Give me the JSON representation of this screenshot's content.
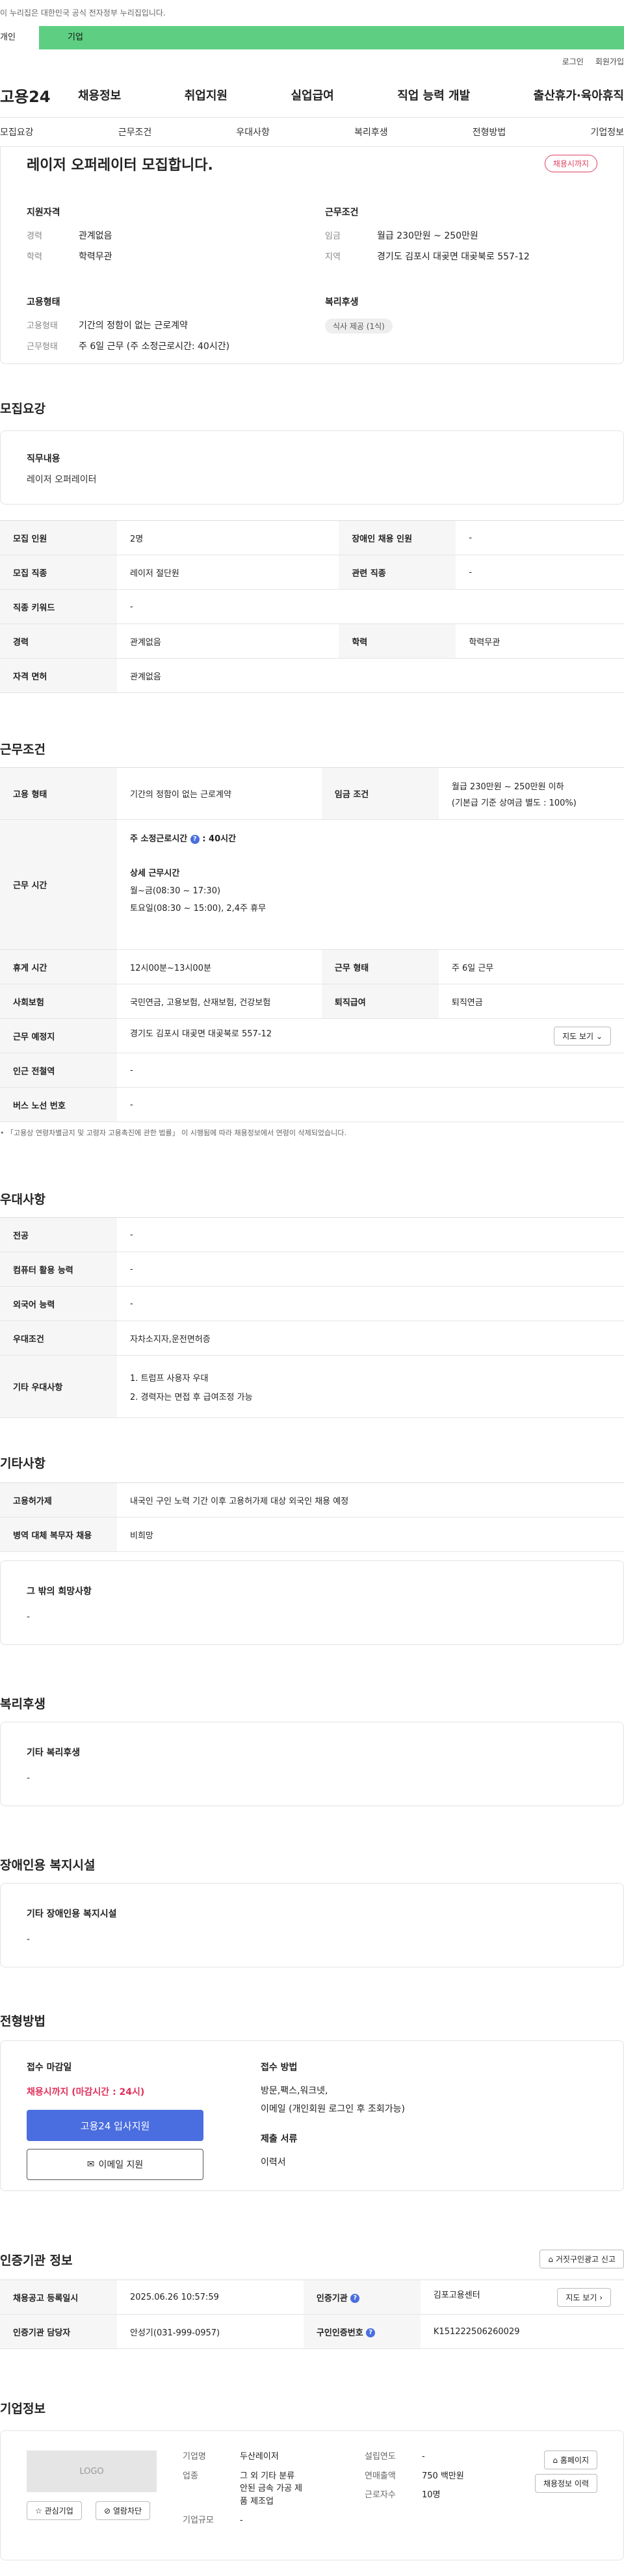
{
  "gov_notice": "이 누리집은 대한민국 공식 전자정부 누리집입니다.",
  "top_tabs": {
    "individual": "개인",
    "company": "기업"
  },
  "util": {
    "login": "로그인",
    "join": "회원가입"
  },
  "logo": "고용24",
  "gnb": [
    "채용정보",
    "취업지원",
    "실업급여",
    "직업 능력 개발",
    "출산휴가·육아휴직"
  ],
  "subnav": [
    "모집요강",
    "근무조건",
    "우대사항",
    "복리후생",
    "전형방법",
    "기업정보"
  ],
  "summary": {
    "title": "레이저 오퍼레이터 모집합니다.",
    "badge": "채용시까지",
    "qual_h": "지원자격",
    "qual": [
      {
        "k": "경력",
        "v": "관계없음"
      },
      {
        "k": "학력",
        "v": "학력무관"
      }
    ],
    "cond_h": "근무조건",
    "cond": [
      {
        "k": "임금",
        "v": "월급 230만원 ~ 250만원"
      },
      {
        "k": "지역",
        "v": "경기도 김포시 대곶면 대곶북로 557-12"
      }
    ],
    "emp_h": "고용형태",
    "emp": [
      {
        "k": "고용형태",
        "v": "기간의 정함이 없는 근로계약"
      },
      {
        "k": "근무형태",
        "v": "주 6일 근무 (주 소정근로시간: 40시간)"
      }
    ],
    "welfare_h": "복리후생",
    "welfare_chip": "식사 제공 (1식)"
  },
  "recruit": {
    "title": "모집요강",
    "job_lbl": "직무내용",
    "job_val": "레이저 오퍼레이터",
    "rows": [
      [
        "모집 인원",
        "2명",
        "장애인 채용 인원",
        "-"
      ],
      [
        "모집 직종",
        "레이저 절단원",
        "관련 직종",
        "-"
      ],
      [
        "직종 키워드",
        "-",
        "",
        ""
      ],
      [
        "경력",
        "관계없음",
        "학력",
        "학력무관"
      ],
      [
        "자격 면허",
        "관계없음",
        "",
        ""
      ]
    ]
  },
  "work": {
    "title": "근무조건",
    "type_k": "고용 형태",
    "type_v": "기간의 정함이 없는 근로계약",
    "wage_k": "임금 조건",
    "wage_v1": "월급 230만원 ~ 250만원 이하",
    "wage_v2": "(기본급 기준 상여금 별도 : 100%)",
    "hours_k": "근무 시간",
    "hours_main": "주 소정근로시간",
    "hours_num": ": 40시간",
    "hours_detail_h": "상세 근무시간",
    "hours_d1": "월~금(08:30 ~ 17:30)",
    "hours_d2": "토요일(08:30 ~ 15:00), 2,4주 휴무",
    "rest_k": "휴게 시간",
    "rest_v": "12시00분~13시00분",
    "form_k": "근무 형태",
    "form_v": "주 6일 근무",
    "ins_k": "사회보험",
    "ins_v": "국민연금, 고용보험, 산재보험, 건강보험",
    "sev_k": "퇴직급여",
    "sev_v": "퇴직연금",
    "place_k": "근무 예정지",
    "place_v": "경기도 김포시 대곶면 대곶북로 557-12",
    "map_btn": "지도 보기",
    "sub_k": "인근 전철역",
    "sub_v": "-",
    "bus_k": "버스 노선 번호",
    "bus_v": "-",
    "note": "「고용상 연령차별금지 및 고령자 고용촉진에 관한 법률」 이 시행됨에 따라 채용정보에서 연령이 삭제되었습니다."
  },
  "pref": {
    "title": "우대사항",
    "rows": [
      [
        "전공",
        "-"
      ],
      [
        "컴퓨터 활용 능력",
        "-"
      ],
      [
        "외국어 능력",
        "-"
      ],
      [
        "우대조건",
        "자차소지자,운전면허증"
      ]
    ],
    "etc_k": "기타 우대사항",
    "etc_1": "1. 트럼프 사용자 우대",
    "etc_2": "2. 경력자는 면접 후 급여조정 가능"
  },
  "other": {
    "title": "기타사항",
    "rows": [
      [
        "고용허가제",
        "내국인 구인 노력 기간 이후 고용허가제 대상 외국인 채용 예정"
      ],
      [
        "병역 대체 복무자 채용",
        "비희망"
      ]
    ],
    "wish_lbl": "그 밖의 희망사항",
    "wish_val": "-"
  },
  "welfare": {
    "title": "복리후생",
    "lbl": "기타 복리후생",
    "val": "-"
  },
  "disab": {
    "title": "장애인용 복지시설",
    "lbl": "기타 장애인용 복지시설",
    "val": "-"
  },
  "apply": {
    "title": "전형방법",
    "deadline_h": "접수 마감일",
    "deadline_v": "채용시까지 (마감시간 : 24시)",
    "apply_btn": "고용24 입사지원",
    "email_btn": "이메일 지원",
    "method_h": "접수 방법",
    "method_v1": "방문,팩스,워크넷,",
    "method_v2": "이메일 (개인회원 로그인 후 조회가능)",
    "docs_h": "제출 서류",
    "docs_v": "이력서"
  },
  "agency": {
    "title": "인증기관 정보",
    "report_btn": "거짓구인광고 신고",
    "reg_k": "채용공고 등록일시",
    "reg_v": "2025.06.26 10:57:59",
    "org_k": "인증기관",
    "org_v": "김포고용센터",
    "map_btn": "지도 보기",
    "mgr_k": "인증기관 담당자",
    "mgr_v": "안성기(031-999-0957)",
    "num_k": "구인인증번호",
    "num_v": "K151222506260029"
  },
  "company": {
    "title": "기업정보",
    "logo": "LOGO",
    "fav_btn": "관심기업",
    "block_btn": "열람차단",
    "name_k": "기업명",
    "name_v": "두산레이저",
    "ind_k": "업종",
    "ind_v1": "그 외 기타 분류",
    "ind_v2": "안된 금속 가공 제",
    "ind_v3": "품 제조업",
    "size_k": "기업규모",
    "size_v": "-",
    "est_k": "설립연도",
    "est_v": "-",
    "rev_k": "연매출액",
    "rev_v": "750 백만원",
    "emp_k": "근로자수",
    "emp_v": "10명",
    "home_btn": "홈페이지",
    "hist_btn": "채용정보 이력"
  }
}
